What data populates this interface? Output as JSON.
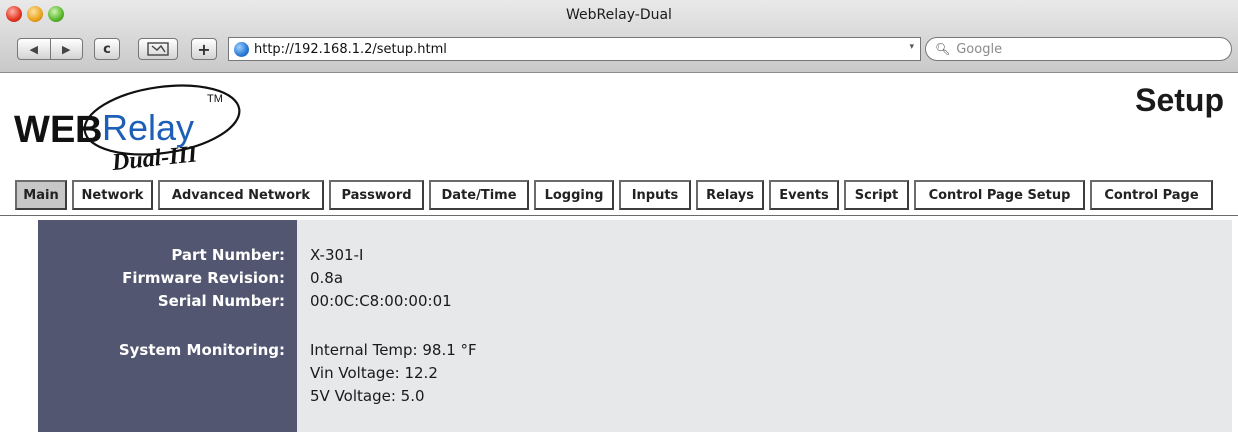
{
  "window": {
    "title": "WebRelay-Dual"
  },
  "toolbar": {
    "back_glyph": "◀",
    "forward_glyph": "▶",
    "reload_glyph": "c",
    "add_glyph": "+",
    "url": "http://192.168.1.2/setup.html",
    "search_placeholder": "Google"
  },
  "header": {
    "logo_text": "WEBRelay",
    "logo_tm": "TM",
    "logo_sub": "Dual-III",
    "page_heading": "Setup"
  },
  "tabs": [
    {
      "label": "Main",
      "active": true
    },
    {
      "label": "Network",
      "active": false
    },
    {
      "label": "Advanced Network",
      "active": false
    },
    {
      "label": "Password",
      "active": false
    },
    {
      "label": "Date/Time",
      "active": false
    },
    {
      "label": "Logging",
      "active": false
    },
    {
      "label": "Inputs",
      "active": false
    },
    {
      "label": "Relays",
      "active": false
    },
    {
      "label": "Events",
      "active": false
    },
    {
      "label": "Script",
      "active": false
    },
    {
      "label": "Control Page Setup",
      "active": false
    },
    {
      "label": "Control Page",
      "active": false
    }
  ],
  "info": {
    "part_number_label": "Part Number:",
    "part_number": "X-301-I",
    "firmware_label": "Firmware Revision:",
    "firmware": "0.8a",
    "serial_label": "Serial Number:",
    "serial": "00:0C:C8:00:00:01",
    "monitoring_label": "System Monitoring:",
    "internal_temp": "Internal Temp: 98.1 °F",
    "vin_voltage": "Vin Voltage: 12.2",
    "v5_voltage": "5V Voltage: 5.0"
  },
  "colors": {
    "panel_label_bg": "#525670",
    "panel_value_bg": "#e7e8ea",
    "active_tab_bg": "#c7c7c7"
  }
}
